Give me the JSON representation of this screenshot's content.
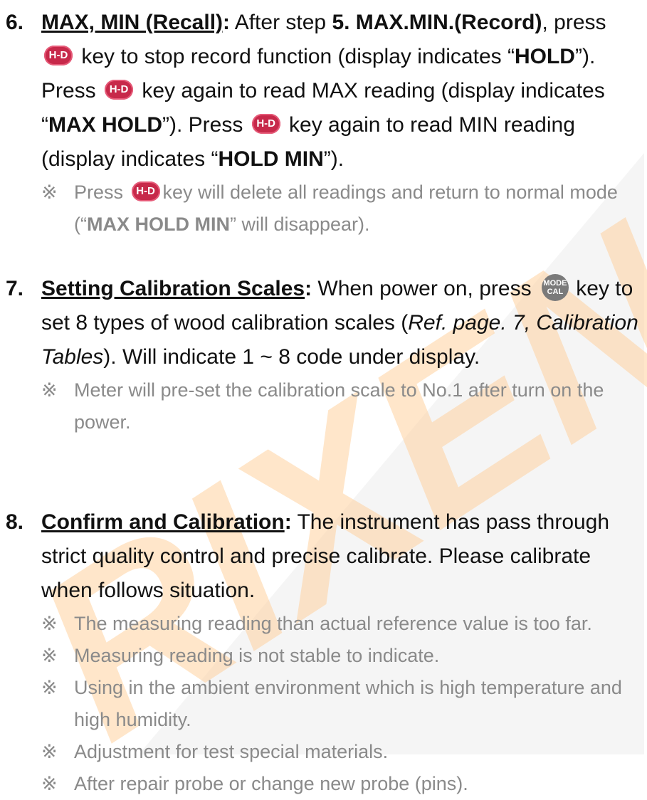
{
  "colors": {
    "text": "#111111",
    "note_text": "#8a8a8a",
    "key_hd": "#c7294a",
    "key_mode": "#7a7a7a",
    "watermark": "#ffd2a0"
  },
  "keys": {
    "hd_label": "H-D",
    "mode_top": "MODE",
    "mode_bottom": "CAL"
  },
  "watermark": {
    "text": "RIXEN"
  },
  "s6": {
    "number": "6.",
    "heading": "MAX, MIN (Recall)",
    "colon": ":",
    "t1": " After step ",
    "t1b": "5. MAX.MIN.(Record)",
    "t2": ", press ",
    "t3": " key to stop record function (display indicates “",
    "hold": "HOLD",
    "t4": "”). Press ",
    "t5": " key again to read MAX reading (display indicates “",
    "max_hold": "MAX HOLD",
    "t6": "”). Press ",
    "t7": " key again to read MIN reading (display indicates “",
    "hold_min": "HOLD MIN",
    "t8": "”).",
    "note_mark": "※",
    "note_a": "Press ",
    "note_b": "key will delete all readings and return to normal mode (“",
    "note_bold": "MAX HOLD MIN",
    "note_c": "” will disappear)."
  },
  "s7": {
    "number": "7.",
    "heading": "Setting Calibration Scales",
    "colon": ":",
    "t1": " When power on, press ",
    "t2": " key to set 8 types of wood calibration scales (",
    "ref": "Ref. page. 7, Calibration Tables",
    "t3": "). Will indicate 1 ~ 8 code under display.",
    "note_mark": "※",
    "note": "Meter will pre-set the calibration scale to No.1 after turn on the power."
  },
  "s8": {
    "number": "8.",
    "heading": "Confirm and Calibration",
    "colon": ":",
    "t1": " The instrument has pass through strict quality control and precise calibrate. Please calibrate when follows situation.",
    "notes": [
      {
        "mark": "※",
        "text": "The measuring reading than actual reference value is too far."
      },
      {
        "mark": "※",
        "text": "Measuring reading is not stable to indicate."
      },
      {
        "mark": "※",
        "text": "Using in the ambient environment which is high temperature and high humidity."
      },
      {
        "mark": "※",
        "text": "Adjustment for test special materials."
      },
      {
        "mark": "※",
        "text": "After repair probe or change new probe (pins)."
      }
    ]
  }
}
